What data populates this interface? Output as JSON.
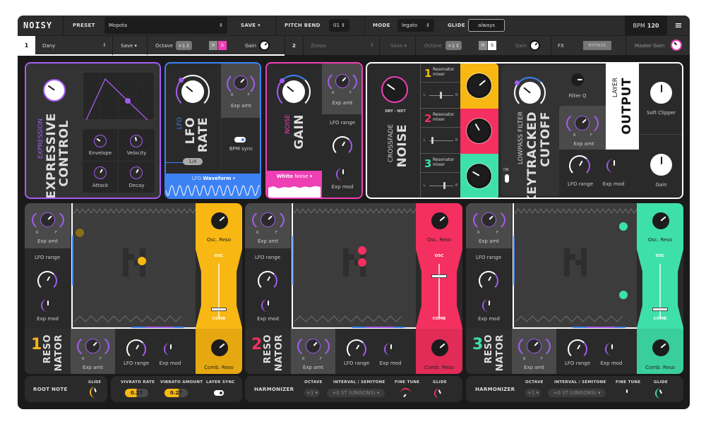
{
  "app": {
    "logo": "NOISY",
    "preset_label": "PRESET",
    "preset_value": "Mopota",
    "save": "SAVE",
    "pitch_bend_label": "PITCH BEND",
    "pitch_bend_value": "01",
    "mode_label": "MODE",
    "mode_value": "legato",
    "glide_label": "GLIDE",
    "glide_value": "always",
    "bpm_label": "BPM",
    "bpm_value": "120",
    "menu_icon": "hamburger-icon"
  },
  "layers": [
    {
      "num": "1",
      "name": "Dany",
      "save": "Save",
      "octave_label": "Octave",
      "octave_value": "+1",
      "m": "M",
      "s": "S",
      "gain": "Gain"
    },
    {
      "num": "2",
      "name": "Zoxoa",
      "save": "Save",
      "octave_label": "Octave",
      "octave_value": "+1",
      "m": "M",
      "s": "S",
      "gain": "Gain"
    }
  ],
  "fx": {
    "label": "FX",
    "bypass": "BYPASS",
    "master_gain": "Master Gain"
  },
  "expression": {
    "small": "EXPRESSION",
    "title1": "EXPRESSIVE",
    "title2": "CONTROL",
    "knobs": [
      "Envelope",
      "Velocity",
      "Attack",
      "Decay"
    ]
  },
  "lfo": {
    "small": "LFO",
    "title1": "LFO",
    "title2": "RATE",
    "exp_amt": "Exp amt",
    "r": "R",
    "f": "F",
    "bpm_sync": "BPM sync",
    "rate_value": "1/4",
    "waveform_prefix": "LFO",
    "waveform_value": "Waveform"
  },
  "noise": {
    "small": "NOISE",
    "title": "GAIN",
    "exp_amt": "Exp amt",
    "r": "R",
    "f": "F",
    "lfo_range": "LFO range",
    "exp_mod": "Exp mod",
    "type_bold": "White",
    "type_rest": "Noise"
  },
  "crossfade": {
    "drywet": "DRY - WET",
    "small": "CROSSFADE",
    "title": "NOISE",
    "mixers": [
      {
        "num": "1",
        "label": "Resonator mixer",
        "color": "#f9b713"
      },
      {
        "num": "2",
        "label": "Resonator mixer",
        "color": "#f3305f"
      },
      {
        "num": "3",
        "label": "Resonator mixer",
        "color": "#3ee0a9"
      }
    ],
    "l": "L",
    "r": "R"
  },
  "filter": {
    "small": "LOWPASS FILTER",
    "title1": "KEYTRACKED",
    "title2": "CUTOFF",
    "filter_q": "Filter Q",
    "exp_amt": "Exp amt",
    "r": "R",
    "f": "F",
    "lfo_range": "LFO range",
    "exp_mod": "Exp mod",
    "on": "ON"
  },
  "output": {
    "small": "LAYER",
    "title": "OUTPUT",
    "soft_clipper": "Soft Clipper",
    "gain": "Gain"
  },
  "resonators": [
    {
      "num": "1",
      "title1": "RESO",
      "title2": "NATOR",
      "color": "#f9b713",
      "exp_amt": "Exp amt",
      "r": "R",
      "f": "F",
      "lfo_range": "LFO range",
      "exp_mod": "Exp mod",
      "osc_reso": "Osc. Reso",
      "osc": "OSC",
      "comb": "COMB",
      "comb_reso": "Comb. Reso"
    },
    {
      "num": "2",
      "title1": "RESO",
      "title2": "NATOR",
      "color": "#f3305f",
      "exp_amt": "Exp amt",
      "r": "R",
      "f": "F",
      "lfo_range": "LFO range",
      "exp_mod": "Exp mod",
      "osc_reso": "Osc. Reso",
      "osc": "OSC",
      "comb": "COMB",
      "comb_reso": "Comb. Reso"
    },
    {
      "num": "3",
      "title1": "RESO",
      "title2": "NATOR",
      "color": "#3ee0a9",
      "exp_amt": "Exp amt",
      "r": "R",
      "f": "F",
      "lfo_range": "LFO range",
      "exp_mod": "Exp mod",
      "osc_reso": "Osc. Reso",
      "osc": "OSC",
      "comb": "COMB",
      "comb_reso": "Comb. Reso"
    }
  ],
  "bottom": {
    "root_note": "ROOT NOTE",
    "glide": "GLIDE",
    "vibrato_rate_label": "VIVRATO RATE",
    "vibrato_rate_value": "0.27",
    "vibrato_rate_fraction": 0.5,
    "vibrato_amount_label": "VIBRATO AMOUNT",
    "vibrato_amount_value": "0.27",
    "vibrato_amount_fraction": 0.6,
    "layer_sync": "LAYER SYNC",
    "harmonizers": [
      {
        "title": "HARMONIZER",
        "octave_label": "OCTAVE",
        "octave_value": "+1",
        "interval_label": "INTERVAL / SEMITONE",
        "interval_value": "+0 ST (UNISONS)",
        "fine_tune": "FINE TUNE",
        "glide": "GLIDE"
      },
      {
        "title": "HARMONIZER",
        "octave_label": "OCTAVE",
        "octave_value": "+1",
        "interval_label": "INTERVAL / SEMITONE",
        "interval_value": "+0 ST (UNISONS)",
        "fine_tune": "FINE TUNE",
        "glide": "GLIDE"
      }
    ]
  },
  "colors": {
    "purple": "#a45cf0",
    "blue": "#3d82f5",
    "pink": "#ee3fb5",
    "yellow": "#f9b713",
    "red": "#f3305f",
    "green": "#3ee0a9"
  }
}
